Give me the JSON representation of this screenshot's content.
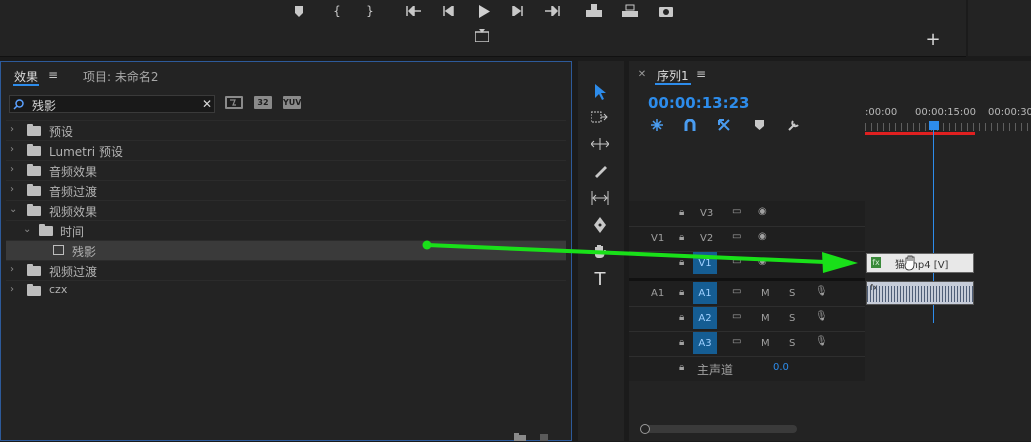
{
  "transport": {
    "icons": [
      "marker-icon",
      "in-point-icon",
      "out-point-icon",
      "go-to-in-icon",
      "step-back-icon",
      "play-icon",
      "step-forward-icon",
      "go-to-out-icon",
      "insert-icon",
      "overwrite-icon",
      "camera-icon",
      "export-frame-icon",
      "add-button-icon"
    ]
  },
  "effects_panel": {
    "tab_effects": "效果",
    "tab_project": "项目: 未命名2",
    "search_value": "残影",
    "badges": [
      "32",
      "YUV"
    ],
    "tree": [
      {
        "label": "预设",
        "type": "preset-folder"
      },
      {
        "label": "Lumetri 预设",
        "type": "preset-folder"
      },
      {
        "label": "音频效果",
        "type": "folder"
      },
      {
        "label": "音频过渡",
        "type": "folder"
      },
      {
        "label": "视频效果",
        "type": "folder",
        "expanded": true
      },
      {
        "label": "时间",
        "type": "folder",
        "expanded": true
      },
      {
        "label": "残影",
        "type": "effect",
        "selected": true
      },
      {
        "label": "视频过渡",
        "type": "folder"
      },
      {
        "label": "czx",
        "type": "folder"
      }
    ]
  },
  "timeline": {
    "sequence_name": "序列1",
    "timecode": "00:00:13:23",
    "ruler": [
      ":00:00",
      "00:00:15:00",
      "00:00:30"
    ],
    "tracks": [
      {
        "source": "",
        "name": "V3"
      },
      {
        "source": "V1",
        "name": "V2"
      },
      {
        "source": "",
        "name": "V1"
      },
      {
        "source": "A1",
        "name": "A1"
      },
      {
        "source": "",
        "name": "A2"
      },
      {
        "source": "",
        "name": "A3"
      }
    ],
    "mute": "M",
    "solo": "S",
    "master_label": "主声道",
    "master_value": "0.0",
    "clip_video_label": "猫.mp4 [V]",
    "clip_fx": "fx"
  },
  "colors": {
    "accent_blue": "#2d8ceb",
    "playhead_red": "#e02020",
    "drag_arrow": "#19e019"
  }
}
